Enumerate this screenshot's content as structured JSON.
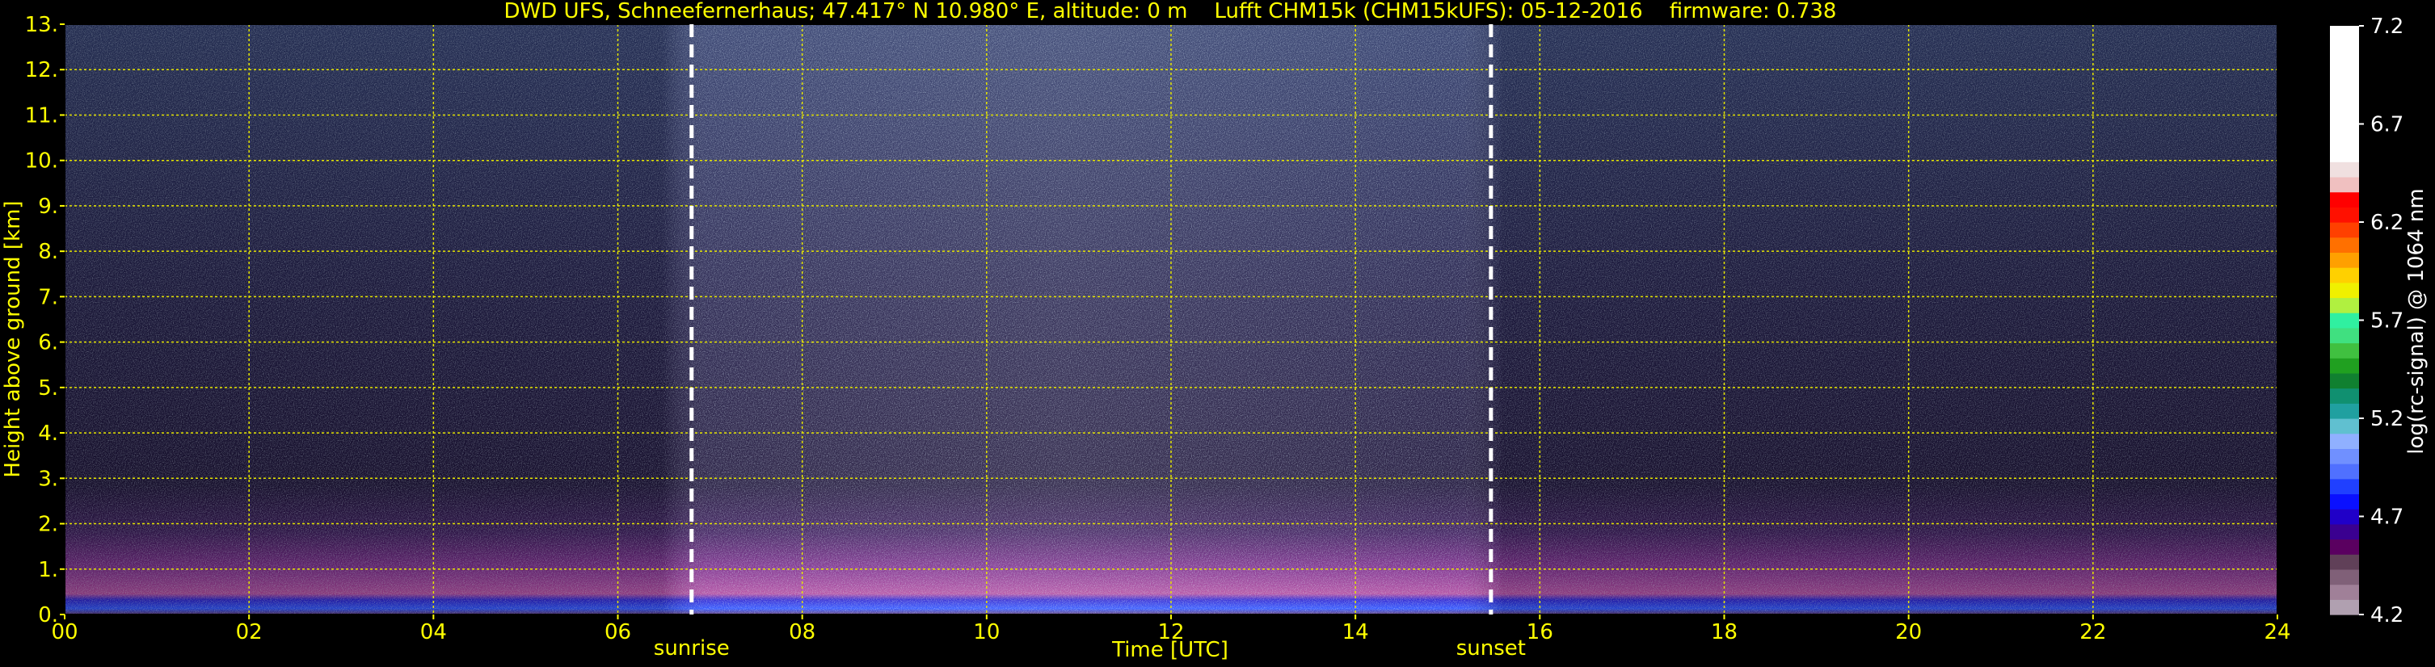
{
  "chart_data": {
    "type": "heatmap",
    "title": "DWD UFS, Schneefernerhaus; 47.417° N 10.980° E, altitude: 0 m    Lufft CHM15k (CHM15kUFS): 05-12-2016    firmware: 0.738",
    "xlabel": "Time [UTC]",
    "ylabel": "Height above ground [km]",
    "xlim": [
      0,
      24
    ],
    "ylim": [
      0,
      13
    ],
    "x_ticks": [
      "00",
      "02",
      "04",
      "06",
      "08",
      "10",
      "12",
      "14",
      "16",
      "18",
      "20",
      "22",
      "24"
    ],
    "y_ticks": [
      "0.",
      "1.",
      "2.",
      "3.",
      "4.",
      "5.",
      "6.",
      "7.",
      "8.",
      "9.",
      "10.",
      "11.",
      "12.",
      "13."
    ],
    "grid": true,
    "annotations": [
      {
        "label": "sunrise",
        "x": 6.8
      },
      {
        "label": "sunset",
        "x": 15.47
      }
    ],
    "colorbar": {
      "label": "log(rc-signal) @ 1064 nm",
      "range": [
        4.2,
        7.2
      ],
      "ticks": [
        "4.2",
        "4.7",
        "5.2",
        "5.7",
        "6.2",
        "6.7",
        "7.2"
      ],
      "colors": [
        "#b0a0b0",
        "#a08098",
        "#806078",
        "#604058",
        "#5a0060",
        "#3a0090",
        "#2000c8",
        "#0a10ff",
        "#2040ff",
        "#5070ff",
        "#7090ff",
        "#90b0ff",
        "#60c0d0",
        "#20a0a0",
        "#109070",
        "#108030",
        "#20a020",
        "#40c040",
        "#40e080",
        "#30f0a0",
        "#b0f040",
        "#f0f000",
        "#ffd000",
        "#ffa000",
        "#ff7000",
        "#ff4000",
        "#ff1000",
        "#ff0000",
        "#f0c0c0",
        "#f0e0e0",
        "#ffffff",
        "#ffffff",
        "#ffffff",
        "#ffffff",
        "#ffffff",
        "#ffffff",
        "#ffffff",
        "#ffffff",
        "#ffffff"
      ]
    }
  },
  "colors": {
    "axis_text": "#ffff00",
    "grid": "#e6e600",
    "background": "#000000",
    "colorbar_text": "#ffffff",
    "marker_line": "#ffffff"
  }
}
